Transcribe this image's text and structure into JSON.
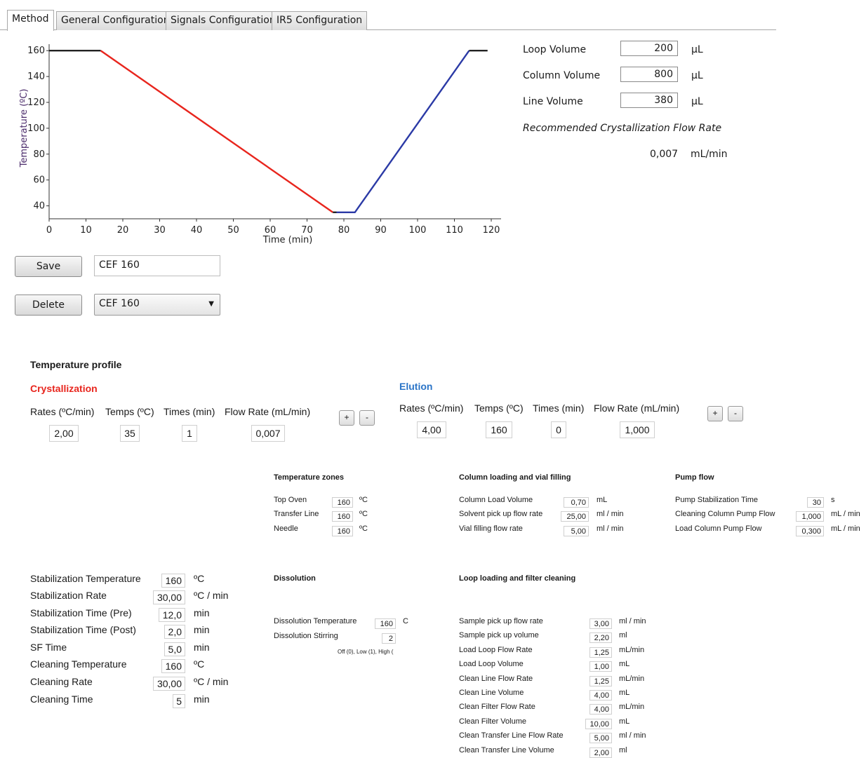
{
  "tabs": [
    "Method",
    "General Configuration",
    "Signals Configuration",
    "IR5 Configuration"
  ],
  "volumes": {
    "loop_label": "Loop Volume",
    "loop_value": "200",
    "loop_unit": "µL",
    "column_label": "Column Volume",
    "column_value": "800",
    "column_unit": "µL",
    "line_label": "Line Volume",
    "line_value": "380",
    "line_unit": "µL",
    "recommended_label": "Recommended Crystallization Flow Rate",
    "recommended_value": "0,007",
    "recommended_unit": "mL/min"
  },
  "chart_data": {
    "type": "line",
    "xlabel": "Time (min)",
    "ylabel": "Temperature (ºC)",
    "xlim": [
      0,
      120
    ],
    "ylim": [
      30,
      165
    ],
    "x_ticks": [
      0,
      10,
      20,
      30,
      40,
      50,
      60,
      70,
      80,
      90,
      100,
      110,
      120
    ],
    "y_ticks": [
      40,
      60,
      80,
      100,
      120,
      140,
      160
    ],
    "series": [
      {
        "color": "#222222",
        "points": [
          [
            0,
            160
          ],
          [
            14,
            160
          ]
        ]
      },
      {
        "color": "#e8251d",
        "points": [
          [
            14,
            160
          ],
          [
            77,
            35
          ]
        ]
      },
      {
        "color": "#222222",
        "points": [
          [
            77,
            35
          ],
          [
            78,
            35
          ]
        ]
      },
      {
        "color": "#2b3aa6",
        "points": [
          [
            78,
            35
          ],
          [
            83,
            35
          ],
          [
            114,
            160
          ]
        ]
      },
      {
        "color": "#222222",
        "points": [
          [
            114,
            160
          ],
          [
            119,
            160
          ]
        ]
      }
    ]
  },
  "method": {
    "save_label": "Save",
    "name_value": "CEF 160",
    "delete_label": "Delete",
    "select_value": "CEF 160"
  },
  "profile": {
    "title": "Temperature profile",
    "crystallization": {
      "title": "Crystallization",
      "headers": [
        "Rates (ºC/min)",
        "Temps (ºC)",
        "Times (min)",
        "Flow Rate (mL/min)"
      ],
      "values": [
        "2,00",
        "35",
        "1",
        "0,007"
      ]
    },
    "elution": {
      "title": "Elution",
      "headers": [
        "Rates (ºC/min)",
        "Temps (ºC)",
        "Times (min)",
        "Flow Rate (mL/min)"
      ],
      "values": [
        "4,00",
        "160",
        "0",
        "1,000"
      ]
    },
    "plus": "+",
    "minus": "-"
  },
  "temp_zones": {
    "title": "Temperature zones",
    "rows": [
      {
        "label": "Top Oven",
        "value": "160",
        "unit": "ºC"
      },
      {
        "label": "Transfer Line",
        "value": "160",
        "unit": "ºC"
      },
      {
        "label": "Needle",
        "value": "160",
        "unit": "ºC"
      }
    ]
  },
  "column_loading": {
    "title": "Column loading and vial filling",
    "rows": [
      {
        "label": "Column Load Volume",
        "value": "0,70",
        "unit": "mL"
      },
      {
        "label": "Solvent pick up flow rate",
        "value": "25,00",
        "unit": "ml / min"
      },
      {
        "label": "Vial filling flow rate",
        "value": "5,00",
        "unit": "ml / min"
      }
    ]
  },
  "pump_flow": {
    "title": "Pump flow",
    "rows": [
      {
        "label": "Pump Stabilization Time",
        "value": "30",
        "unit": "s"
      },
      {
        "label": "Cleaning Column Pump Flow",
        "value": "1,000",
        "unit": "mL / min"
      },
      {
        "label": "Load Column Pump Flow",
        "value": "0,300",
        "unit": "mL / min"
      }
    ]
  },
  "stabilization": {
    "rows": [
      {
        "label": "Stabilization Temperature",
        "value": "160",
        "unit": "ºC"
      },
      {
        "label": "Stabilization Rate",
        "value": "30,00",
        "unit": "ºC / min"
      },
      {
        "label": "Stabilization Time (Pre)",
        "value": "12,0",
        "unit": "min"
      },
      {
        "label": "Stabilization Time (Post)",
        "value": "2,0",
        "unit": "min"
      },
      {
        "label": "SF Time",
        "value": "5,0",
        "unit": "min"
      },
      {
        "label": "Cleaning Temperature",
        "value": "160",
        "unit": "ºC"
      },
      {
        "label": "Cleaning Rate",
        "value": "30,00",
        "unit": "ºC / min"
      },
      {
        "label": "Cleaning Time",
        "value": "5",
        "unit": "min"
      }
    ]
  },
  "dissolution": {
    "title": "Dissolution",
    "temp_label": "Dissolution Temperature",
    "temp_value": "160",
    "temp_unit": "C",
    "stir_label": "Dissolution Stirring",
    "stir_value": "2",
    "stir_hint": "Off (0), Low (1), High ("
  },
  "loop_loading": {
    "title": "Loop loading and filter cleaning",
    "rows": [
      {
        "label": "Sample pick up flow rate",
        "value": "3,00",
        "unit": "ml / min"
      },
      {
        "label": "Sample pick up volume",
        "value": "2,20",
        "unit": "ml"
      },
      {
        "label": "Load Loop Flow Rate",
        "value": "1,25",
        "unit": "mL/min"
      },
      {
        "label": "Load Loop Volume",
        "value": "1,00",
        "unit": "mL"
      },
      {
        "label": "Clean Line Flow Rate",
        "value": "1,25",
        "unit": "mL/min"
      },
      {
        "label": "Clean Line Volume",
        "value": "4,00",
        "unit": "mL"
      },
      {
        "label": "Clean Filter Flow Rate",
        "value": "4,00",
        "unit": "mL/min"
      },
      {
        "label": "Clean Filter Volume",
        "value": "10,00",
        "unit": "mL"
      },
      {
        "label": "Clean Transfer Line Flow Rate",
        "value": "5,00",
        "unit": "ml / min"
      },
      {
        "label": "Clean Transfer Line Volume",
        "value": "2,00",
        "unit": "ml"
      }
    ]
  }
}
